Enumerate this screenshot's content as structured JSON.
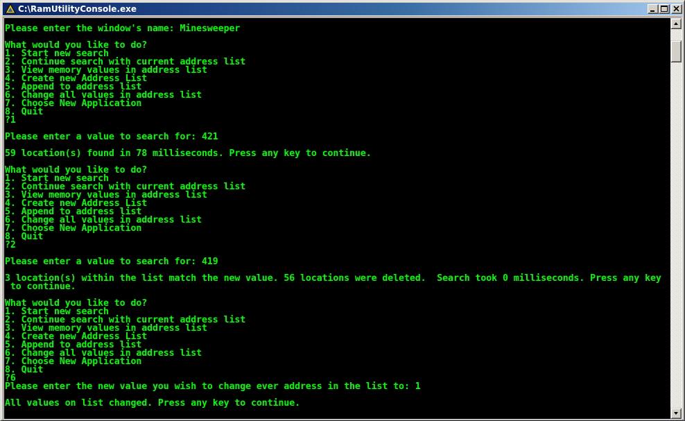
{
  "window": {
    "title": "C:\\RamUtilityConsole.exe",
    "icon": "console-app-icon"
  },
  "titlebar_buttons": {
    "minimize_icon": "minimize-icon",
    "maximize_icon": "maximize-icon",
    "close_icon": "close-icon"
  },
  "colors": {
    "console_background": "#000000",
    "console_text": "#00ff00",
    "titlebar_start": "#0a246a",
    "titlebar_end": "#a6caf0"
  },
  "console": {
    "lines": [
      "Please enter the window's name: Minesweeper",
      "",
      "What would you like to do?",
      "1. Start new search",
      "2. Continue search with current address list",
      "3. View memory values in address list",
      "4. Create new Address List",
      "5. Append to address list",
      "6. Change all values in address list",
      "7. Choose New Application",
      "8. Quit",
      "?1",
      "",
      "Please enter a value to search for: 421",
      "",
      "59 location(s) found in 78 milliseconds. Press any key to continue.",
      "",
      "What would you like to do?",
      "1. Start new search",
      "2. Continue search with current address list",
      "3. View memory values in address list",
      "4. Create new Address List",
      "5. Append to address list",
      "6. Change all values in address list",
      "7. Choose New Application",
      "8. Quit",
      "?2",
      "",
      "Please enter a value to search for: 419",
      "",
      "3 location(s) within the list match the new value. 56 locations were deleted.  Search took 0 milliseconds. Press any key",
      " to continue.",
      "",
      "What would you like to do?",
      "1. Start new search",
      "2. Continue search with current address list",
      "3. View memory values in address list",
      "4. Create new Address List",
      "5. Append to address list",
      "6. Change all values in address list",
      "7. Choose New Application",
      "8. Quit",
      "?6",
      "Please enter the new value you wish to change ever address in the list to: 1",
      "",
      "All values on list changed. Press any key to continue."
    ]
  },
  "scrollbar": {
    "up_icon": "scroll-up-arrow-icon",
    "down_icon": "scroll-down-arrow-icon"
  }
}
